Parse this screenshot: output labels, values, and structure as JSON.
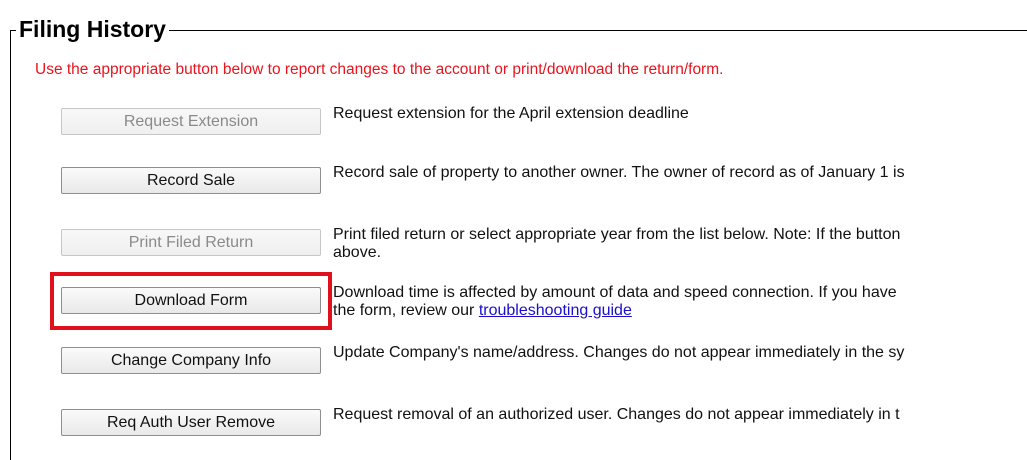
{
  "section": {
    "title": "Filing History",
    "instructions": "Use the appropriate button below to report changes to the account or print/download the return/form."
  },
  "actions": [
    {
      "label": "Request Extension",
      "enabled": false,
      "desc_line1": "Request extension for the April extension deadline",
      "desc_line2": ""
    },
    {
      "label": "Record Sale",
      "enabled": true,
      "desc_line1": "Record sale of property to another owner. The owner of record as of January 1 is",
      "desc_line2": ""
    },
    {
      "label": "Print Filed Return",
      "enabled": false,
      "desc_line1": "Print filed return or select appropriate year from the list below. Note: If the button",
      "desc_line2": "above."
    },
    {
      "label": "Download Form",
      "enabled": true,
      "highlighted": true,
      "desc_line1": "Download time is affected by amount of data and speed connection. If you have",
      "desc_line2_prefix": "the form, review our ",
      "desc_link": "troubleshooting guide"
    },
    {
      "label": "Change Company Info",
      "enabled": true,
      "desc_line1": "Update Company's name/address. Changes do not appear immediately in the sy",
      "desc_line2": ""
    },
    {
      "label": "Req Auth User Remove",
      "enabled": true,
      "desc_line1": "Request removal of an authorized user. Changes do not appear immediately in t",
      "desc_line2": ""
    }
  ],
  "colors": {
    "instruction_text": "#e8141e",
    "highlight_border": "#e0101c",
    "link": "#1a0dcc"
  }
}
